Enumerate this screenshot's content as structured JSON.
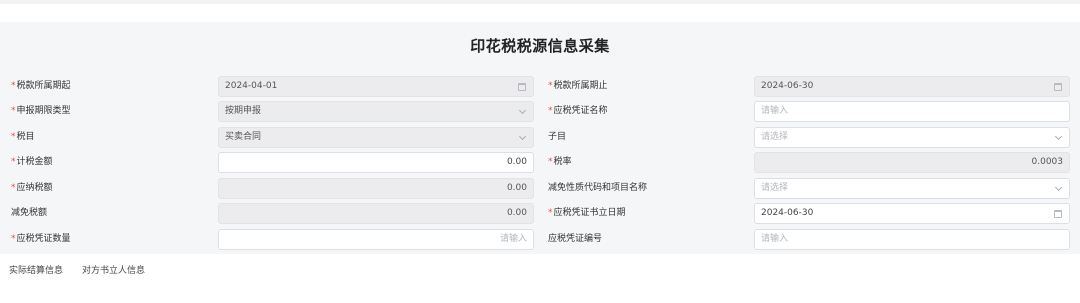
{
  "page": {
    "title": "印花税税源信息采集"
  },
  "left": [
    {
      "label": "税款所属期起",
      "required": true,
      "value": "2024-04-01",
      "placeholder": "",
      "icon": "calendar-icon",
      "disabled": true,
      "align": "left"
    },
    {
      "label": "申报期限类型",
      "required": true,
      "value": "按期申报",
      "placeholder": "",
      "icon": "chevron-down-icon",
      "disabled": true,
      "align": "left"
    },
    {
      "label": "税目",
      "required": true,
      "value": "买卖合同",
      "placeholder": "",
      "icon": "chevron-down-icon",
      "disabled": true,
      "align": "left"
    },
    {
      "label": "计税金额",
      "required": true,
      "value": "0.00",
      "placeholder": "",
      "icon": "",
      "disabled": false,
      "align": "right"
    },
    {
      "label": "应纳税额",
      "required": true,
      "value": "0.00",
      "placeholder": "",
      "icon": "",
      "disabled": true,
      "align": "right"
    },
    {
      "label": "减免税额",
      "required": false,
      "value": "0.00",
      "placeholder": "",
      "icon": "",
      "disabled": true,
      "align": "right"
    },
    {
      "label": "应税凭证数量",
      "required": true,
      "value": "",
      "placeholder": "请输入",
      "icon": "",
      "disabled": false,
      "align": "right"
    }
  ],
  "right": [
    {
      "label": "税款所属期止",
      "required": true,
      "value": "2024-06-30",
      "placeholder": "",
      "icon": "calendar-icon",
      "disabled": true,
      "align": "left"
    },
    {
      "label": "应税凭证名称",
      "required": true,
      "value": "",
      "placeholder": "请输入",
      "icon": "",
      "disabled": false,
      "align": "left"
    },
    {
      "label": "子目",
      "required": false,
      "value": "",
      "placeholder": "请选择",
      "icon": "chevron-down-icon",
      "disabled": false,
      "align": "left"
    },
    {
      "label": "税率",
      "required": true,
      "value": "0.0003",
      "placeholder": "",
      "icon": "",
      "disabled": true,
      "align": "right"
    },
    {
      "label": "减免性质代码和项目名称",
      "required": false,
      "value": "",
      "placeholder": "请选择",
      "icon": "chevron-down-icon",
      "disabled": false,
      "align": "left"
    },
    {
      "label": "应税凭证书立日期",
      "required": true,
      "value": "2024-06-30",
      "placeholder": "",
      "icon": "calendar-icon",
      "disabled": false,
      "align": "left"
    },
    {
      "label": "应税凭证编号",
      "required": false,
      "value": "",
      "placeholder": "请输入",
      "icon": "",
      "disabled": false,
      "align": "left"
    }
  ],
  "tabs": [
    "实际结算信息",
    "对方书立人信息"
  ]
}
